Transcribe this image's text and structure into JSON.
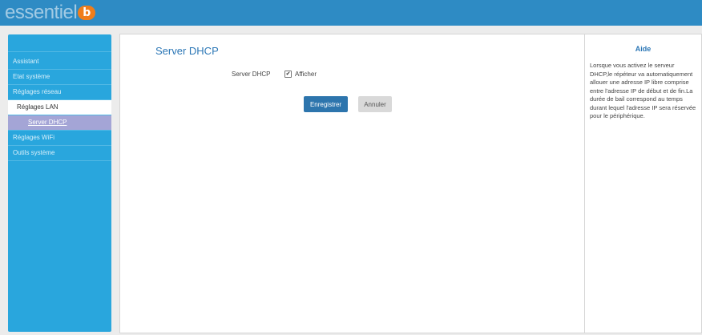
{
  "header": {
    "brand_text": "essentiel",
    "brand_logo_letter": "b"
  },
  "sidebar": {
    "items": [
      {
        "label": "Assistant"
      },
      {
        "label": "Etat système"
      },
      {
        "label": "Réglages réseau"
      },
      {
        "label": "Réglages LAN"
      },
      {
        "label": "Server DHCP"
      },
      {
        "label": "Réglages WiFi"
      },
      {
        "label": "Outils système"
      }
    ]
  },
  "main": {
    "title": "Server DHCP",
    "field_label": "Server DHCP",
    "checkbox_label": "Afficher",
    "checkbox_checked": true,
    "save_label": "Enregistrer",
    "cancel_label": "Annuler"
  },
  "help": {
    "title": "Aide",
    "text": "Lorsque vous activez le serveur DHCP,le répéteur va automatiquement allouer une adresse IP libre comprise entre l'adresse IP de début et de fin.La durée de bail correspond au temps durant lequel l'adresse IP sera réservée pour le périphérique."
  },
  "colors": {
    "topbar": "#2e8bc4",
    "sidebar": "#29a6dd",
    "accent": "#2c77b6",
    "brand_orange": "#f07d1a",
    "selected_item": "#a4a5d6"
  }
}
